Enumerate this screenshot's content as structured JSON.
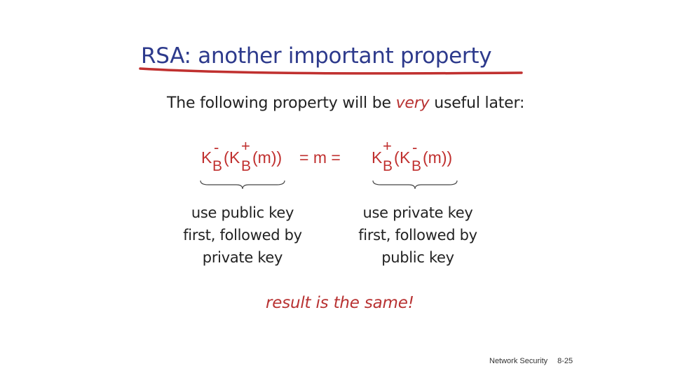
{
  "title": "RSA: another important property",
  "intro": {
    "before": "The following property will be ",
    "emphasis": "very",
    "after": " useful later:"
  },
  "formula": {
    "K": "K",
    "B": "B",
    "plus": "+",
    "minus": "-",
    "open_paren": "(",
    "m_close_left": "(m))",
    "equals_m": "=  m  =",
    "m_close_right": "(m))"
  },
  "captions": {
    "left": [
      "use public key",
      "first, followed by",
      "private key"
    ],
    "right": [
      "use private key",
      "first, followed by",
      "public key"
    ]
  },
  "result": "result is the same!",
  "footer": {
    "section": "Network Security",
    "page": "8-25"
  },
  "colors": {
    "title": "#2d3a8c",
    "accent_red": "#c0302f",
    "underline": "#c0302f"
  }
}
